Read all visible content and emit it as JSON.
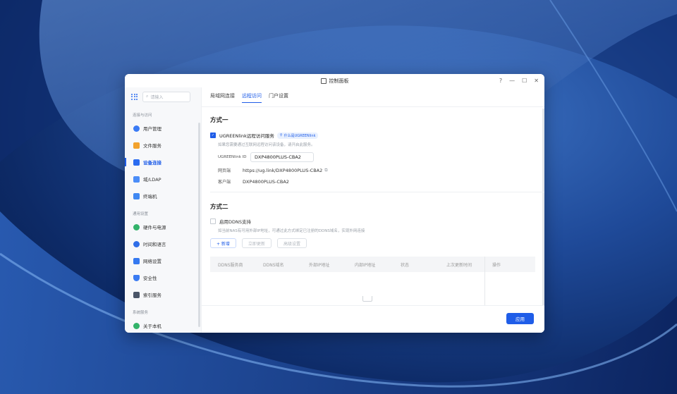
{
  "window": {
    "title": "控制面板",
    "controls": [
      "?",
      "—",
      "☐",
      "✕"
    ]
  },
  "colors": {
    "accent": "#1f5de8"
  },
  "sidebar": {
    "search_placeholder": "请输入",
    "sections": [
      {
        "title": "连接与访问",
        "items": [
          {
            "label": "用户管理",
            "icon": "user-icon",
            "color": "#3b7bf5"
          },
          {
            "label": "文件服务",
            "icon": "folder-icon",
            "color": "#f2a22c"
          },
          {
            "label": "设备连接",
            "icon": "device-icon",
            "color": "#2b6cf0",
            "active": true
          },
          {
            "label": "域/LDAP",
            "icon": "domain-icon",
            "color": "#4b8df8"
          },
          {
            "label": "终端机",
            "icon": "terminal-icon",
            "color": "#3f88f2"
          }
        ]
      },
      {
        "title": "通用设置",
        "items": [
          {
            "label": "硬件与电源",
            "icon": "power-icon",
            "color": "#33b36a"
          },
          {
            "label": "时间和语言",
            "icon": "clock-icon",
            "color": "#2f6ee8"
          },
          {
            "label": "网络设置",
            "icon": "network-icon",
            "color": "#3579f0"
          },
          {
            "label": "安全性",
            "icon": "shield-icon",
            "color": "#3a7bf2"
          },
          {
            "label": "索引服务",
            "icon": "index-icon",
            "color": "#4a5568"
          }
        ]
      },
      {
        "title": "系统服务",
        "items": [
          {
            "label": "关于本机",
            "icon": "info-icon",
            "color": "#33b36a"
          }
        ]
      }
    ]
  },
  "tabs": [
    "局域网连接",
    "远程访问",
    "门户设置"
  ],
  "active_tab": "远程访问",
  "method1": {
    "title": "方式一",
    "service_label": "UGREENlink远程访问服务",
    "service_enabled": true,
    "what_is": "什么是UGREENlink",
    "hint": "如果您需要通过互联网远程访问该设备，请开启此服务。",
    "id_label": "UGREENlink ID",
    "id_value": "DXP4800PLUS-CBA2",
    "web_label": "网页端",
    "web_value": "https://ug.link/DXP4800PLUS-CBA2",
    "client_label": "客户端",
    "client_value": "DXP4800PLUS-CBA2"
  },
  "method2": {
    "title": "方式二",
    "ddns_label": "启用DDNS支持",
    "ddns_enabled": false,
    "hint": "如当前NAS有可用外部IP地址，可通过此方式绑定已注册的DDNS域名，实现外网连接",
    "buttons": [
      "+ 新增",
      "立即更新",
      "高级设置"
    ],
    "table_columns": [
      "DDNS服务商",
      "DDNS域名",
      "外部IP地址",
      "内部IP地址",
      "状态",
      "上次更新时间",
      "操作"
    ]
  },
  "footer": {
    "apply": "应用"
  }
}
